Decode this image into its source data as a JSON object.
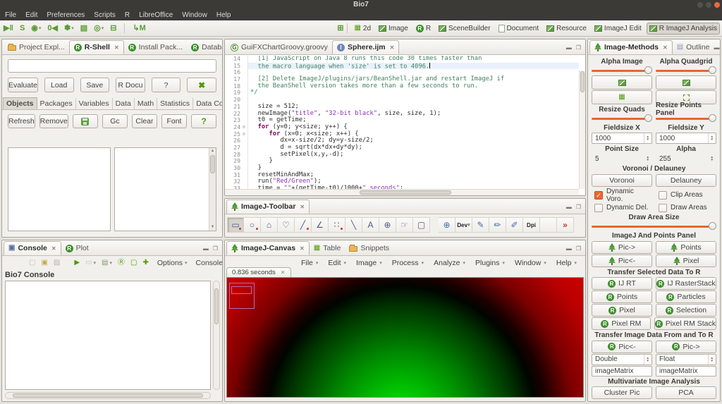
{
  "colors": {
    "accent_orange": "#e4682e",
    "bio7_green": "#4e9a06",
    "roi_purple": "#b06cb6",
    "canvas_center_green": "#00f200",
    "canvas_red": "#ee0000"
  },
  "window": {
    "title": "Bio7",
    "menus": [
      "File",
      "Edit",
      "Preferences",
      "Scripts",
      "R",
      "LibreOffice",
      "Window",
      "Help"
    ]
  },
  "toolbar": {
    "left_icons": [
      {
        "name": "resume-pause-icon",
        "glyph": "▶‖"
      },
      {
        "name": "stop-icon",
        "glyph": "S"
      },
      {
        "name": "terminate-icon",
        "glyph": "◉",
        "dd": true
      },
      {
        "name": "reset-icon",
        "glyph": "0◀"
      },
      {
        "name": "settings-flower-icon",
        "glyph": "✽",
        "dd": true
      },
      {
        "name": "new-script-icon",
        "glyph": "▤"
      },
      {
        "name": "r-run-icon",
        "glyph": "◎",
        "dd": true
      },
      {
        "name": "print-icon",
        "glyph": "⊟"
      },
      {
        "name": "sep"
      },
      {
        "name": "model-chart-icon",
        "glyph": "↳M"
      }
    ],
    "perspective_switch_icon": "⊞",
    "perspectives": [
      {
        "label": "2d",
        "icon": "grid"
      },
      {
        "label": "Image",
        "icon": "img"
      },
      {
        "label": "R",
        "icon": "r"
      },
      {
        "label": "SceneBuilder",
        "icon": "img"
      },
      {
        "label": "Document",
        "icon": "doc"
      },
      {
        "label": "Resource",
        "icon": "img"
      },
      {
        "label": "ImageJ Edit",
        "icon": "img"
      },
      {
        "label": "R ImageJ Analysis",
        "icon": "img",
        "active": true
      }
    ]
  },
  "rshell": {
    "tabs": [
      {
        "label": "Project Expl...",
        "icon": "folder"
      },
      {
        "label": "R-Shell",
        "icon": "r",
        "active": true
      },
      {
        "label": "Install Pack...",
        "icon": "r"
      },
      {
        "label": "Database Co...",
        "icon": "r"
      }
    ],
    "input_value": "",
    "buttons": [
      "Evaluate",
      "Load",
      "Save",
      "R Docu",
      "?"
    ],
    "close_glyph": "✖",
    "subtabs": [
      "Objects",
      "Packages",
      "Variables",
      "Data",
      "Math",
      "Statistics",
      "Data Conversion"
    ],
    "active_subtab": "Objects",
    "actions": [
      {
        "label": "Refresh"
      },
      {
        "label": "Remove"
      },
      {
        "icon": "save",
        "name": "save-objects-button"
      },
      {
        "label": "Gc"
      },
      {
        "label": "Clear"
      },
      {
        "label": "Font"
      },
      {
        "label": "?",
        "green": true
      }
    ]
  },
  "console": {
    "tabs": [
      {
        "label": "Console",
        "icon": "console",
        "active": true
      },
      {
        "label": "Plot",
        "icon": "r"
      }
    ],
    "toolbar_icons": [
      {
        "name": "clear-console-icon",
        "glyph": "▢",
        "c": "#c3beb6"
      },
      {
        "name": "scroll-lock-icon",
        "glyph": "▣",
        "c": "#caa84e"
      },
      {
        "name": "word-wrap-icon",
        "glyph": "▨",
        "c": "#b9b4ac"
      },
      {
        "name": "sep"
      },
      {
        "name": "show-output-icon",
        "glyph": "▶",
        "c": "#4e9a06"
      },
      {
        "name": "pin-console-icon",
        "glyph": "▭",
        "c": "#c3beb6",
        "dd": true
      },
      {
        "name": "open-console-icon",
        "glyph": "▤",
        "c": "#8a9a6a",
        "dd": true
      },
      {
        "name": "r-console-icon",
        "glyph": "Ⓡ",
        "c": "#4e9a06"
      },
      {
        "name": "display-console-icon",
        "glyph": "▢",
        "c": "#4e9a06"
      },
      {
        "name": "new-console-icon",
        "glyph": "✚",
        "c": "#4e9a06"
      }
    ],
    "options_label": "Options",
    "console_label": "Console",
    "title": "Bio7 Console"
  },
  "editor": {
    "tabs": [
      {
        "label": "GuiFXChartGroovy.groovy",
        "icon": "g"
      },
      {
        "label": "Sphere.ijm",
        "icon": "ij",
        "active": true
      }
    ],
    "lines": [
      {
        "n": 14,
        "seg": [
          [
            "cm",
            "  [1] JavaScript on Java 8 runs this code 30 times faster than"
          ]
        ]
      },
      {
        "n": 15,
        "cur": true,
        "cursor": true,
        "seg": [
          [
            "cm",
            "  the macro language when 'size' is set to 4096."
          ]
        ]
      },
      {
        "n": 16,
        "seg": []
      },
      {
        "n": 17,
        "seg": [
          [
            "cm",
            "  [2] Delete ImageJ/plugins/jars/BeanShell.jar and restart ImageJ if"
          ]
        ]
      },
      {
        "n": 18,
        "seg": [
          [
            "cm",
            "  the BeanShell version takes more than a few seconds to run."
          ]
        ]
      },
      {
        "n": 19,
        "seg": [
          [
            "cm",
            "*/"
          ]
        ]
      },
      {
        "n": 20,
        "seg": []
      },
      {
        "n": 21,
        "seg": [
          [
            "pl",
            "  size = 512;"
          ]
        ]
      },
      {
        "n": 22,
        "seg": [
          [
            "pl",
            "  newImage("
          ],
          [
            "str",
            "\"title\""
          ],
          [
            "pl",
            ", "
          ],
          [
            "str",
            "\"32-bit black\""
          ],
          [
            "pl",
            ", size, size, 1);"
          ]
        ]
      },
      {
        "n": 23,
        "seg": [
          [
            "pl",
            "  t0 = getTime;"
          ]
        ]
      },
      {
        "n": 24,
        "fold": true,
        "seg": [
          [
            "pl",
            "  "
          ],
          [
            "kw",
            "for"
          ],
          [
            "pl",
            " (y=0; y<size; y++) {"
          ]
        ]
      },
      {
        "n": 25,
        "fold": true,
        "seg": [
          [
            "pl",
            "     "
          ],
          [
            "kw",
            "for"
          ],
          [
            "pl",
            " (x=0; x<size; x++) {"
          ]
        ]
      },
      {
        "n": 26,
        "seg": [
          [
            "pl",
            "        dx=x-size/2; dy=y-size/2;"
          ]
        ]
      },
      {
        "n": 27,
        "seg": [
          [
            "pl",
            "        d = sqrt(dx*dx+dy*dy);"
          ]
        ]
      },
      {
        "n": 28,
        "seg": [
          [
            "pl",
            "        setPixel(x,y,-d);"
          ]
        ]
      },
      {
        "n": 29,
        "seg": [
          [
            "pl",
            "     }"
          ]
        ]
      },
      {
        "n": 30,
        "seg": [
          [
            "pl",
            "  }"
          ]
        ]
      },
      {
        "n": 31,
        "seg": [
          [
            "pl",
            "  resetMinAndMax;"
          ]
        ]
      },
      {
        "n": 32,
        "seg": [
          [
            "pl",
            "  run("
          ],
          [
            "str",
            "\"Red/Green\""
          ],
          [
            "pl",
            ");"
          ]
        ]
      },
      {
        "n": 33,
        "seg": [
          [
            "pl",
            "  time = "
          ],
          [
            "str",
            "\"\""
          ],
          [
            "pl",
            "+(getTime-t0)/1000+"
          ],
          [
            "str",
            "\" seconds\""
          ],
          [
            "pl",
            ";"
          ]
        ]
      }
    ]
  },
  "imagej_toolbar": {
    "tab": {
      "label": "ImageJ-Toolbar",
      "icon": "tree"
    },
    "tools": [
      {
        "name": "rectangle-tool",
        "glyph": "▭",
        "active": true,
        "dot": true
      },
      {
        "name": "oval-tool",
        "glyph": "○",
        "dot": true
      },
      {
        "name": "polygon-tool",
        "glyph": "⌂"
      },
      {
        "name": "freehand-tool",
        "glyph": "♡"
      },
      {
        "name": "line-tool",
        "glyph": "╱",
        "dot": true
      },
      {
        "name": "angle-tool",
        "glyph": "∠"
      },
      {
        "name": "point-tool",
        "glyph": "∷",
        "dot": true
      },
      {
        "name": "wand-tool",
        "glyph": "╲"
      },
      {
        "name": "text-tool",
        "glyph": "A"
      },
      {
        "name": "magnifier-tool",
        "glyph": "⊕"
      },
      {
        "name": "hand-tool",
        "glyph": "☞"
      },
      {
        "name": "selection-tool",
        "glyph": "▢"
      },
      {
        "name": "sep"
      },
      {
        "name": "zoom-tool",
        "glyph": "⊕",
        "cls": "blue"
      },
      {
        "name": "dev-tool",
        "glyph": "Dev",
        "cls": "small",
        "dd": true
      },
      {
        "name": "brush-tool",
        "glyph": "✎",
        "cls": "blue"
      },
      {
        "name": "pencil-tool",
        "glyph": "✏",
        "cls": "blue"
      },
      {
        "name": "color-picker-tool",
        "glyph": "✐",
        "cls": "blue"
      },
      {
        "name": "dpi-tool",
        "glyph": "Dpi",
        "cls": "small"
      },
      {
        "name": "spare-tool",
        "glyph": ""
      },
      {
        "name": "more-tools",
        "glyph": "»",
        "cls": "red"
      }
    ]
  },
  "canvas": {
    "tabs": [
      {
        "label": "ImageJ-Canvas",
        "icon": "tree",
        "active": true
      },
      {
        "label": "Table",
        "icon": "grid"
      },
      {
        "label": "Snippets",
        "icon": "folder"
      }
    ],
    "menus": [
      "File",
      "Edit",
      "Image",
      "Process",
      "Analyze",
      "Plugins",
      "Window",
      "Help"
    ],
    "image_tab": "0.836 seconds"
  },
  "right_panel": {
    "tabs": [
      {
        "label": "Image-Methods",
        "icon": "tree",
        "active": true
      },
      {
        "label": "Outline",
        "icon": "outline"
      }
    ],
    "rows": [
      {
        "type": "label2",
        "a": "Alpha Image",
        "b": "Alpha Quadgrid"
      },
      {
        "type": "slider2",
        "an": "alpha-image-slider",
        "bn": "alpha-quadgrid-slider"
      },
      {
        "type": "iconbtn2",
        "ai": "img",
        "bi": "img",
        "an": "alpha-image-button",
        "bn": "alpha-quadgrid-button"
      },
      {
        "type": "iconbtn2",
        "ai": "grid",
        "bi": "dash",
        "an": "quadgrid-button",
        "bn": "points-panel-button"
      },
      {
        "type": "label2",
        "a": "Resize Quads",
        "b": "Resize Points Panel"
      },
      {
        "type": "slider2",
        "an": "resize-quads-slider",
        "bn": "resize-points-panel-slider"
      },
      {
        "type": "label2",
        "a": "Fieldsize X",
        "b": "Fieldsize Y"
      },
      {
        "type": "spin2",
        "a": "1000",
        "b": "1000",
        "boxed": true,
        "an": "fieldsize-x-spinner",
        "bn": "fieldsize-y-spinner"
      },
      {
        "type": "label2",
        "a": "Point Size",
        "b": "Alpha"
      },
      {
        "type": "spin2",
        "a": "5",
        "b": "255",
        "boxed": false,
        "an": "point-size-spinner",
        "bn": "alpha-spinner"
      },
      {
        "type": "section",
        "t": "Voronoi / Delauney"
      },
      {
        "type": "btn2",
        "a": "Voronoi",
        "b": "Delauney"
      },
      {
        "type": "check2",
        "a": "Dynamic Voro.",
        "b": "Clip Areas",
        "ac": true
      },
      {
        "type": "check2",
        "a": "Dynamic Del.",
        "b": "Draw Areas"
      },
      {
        "type": "section",
        "t": "Draw Area Size"
      },
      {
        "type": "slider1",
        "an": "draw-area-size-slider"
      },
      {
        "type": "section",
        "t": "ImageJ And Points Panel"
      },
      {
        "type": "btn2",
        "a": "Pic->",
        "b": "Points",
        "icon": "tree"
      },
      {
        "type": "btn2",
        "a": "Pic<-",
        "b": "Pixel",
        "icon": "tree"
      },
      {
        "type": "section",
        "t": "Transfer Selected Data To R"
      },
      {
        "type": "btn2",
        "a": "IJ RT",
        "b": "IJ RasterStack",
        "icon": "r"
      },
      {
        "type": "btn2",
        "a": "Points",
        "b": "Particles",
        "icon": "r"
      },
      {
        "type": "btn2",
        "a": "Pixel",
        "b": "Selection",
        "icon": "r"
      },
      {
        "type": "btn2",
        "a": "Pixel RM",
        "b": "Pixel RM Stack",
        "icon": "r"
      },
      {
        "type": "section",
        "t": "Transfer Image Data From and To R"
      },
      {
        "type": "btn2",
        "a": "Pic<-",
        "b": "Pic->",
        "icon": "r"
      },
      {
        "type": "combo2",
        "a": "Double",
        "b": "Float",
        "an": "double-combo",
        "bn": "float-combo"
      },
      {
        "type": "input2",
        "a": "imageMatrix",
        "b": "imageMatrix",
        "an": "image-matrix-input-1",
        "bn": "image-matrix-input-2"
      },
      {
        "type": "section",
        "t": "Multivariate Image Analysis"
      },
      {
        "type": "btn2",
        "a": "Cluster Pic",
        "b": "PCA"
      }
    ]
  }
}
